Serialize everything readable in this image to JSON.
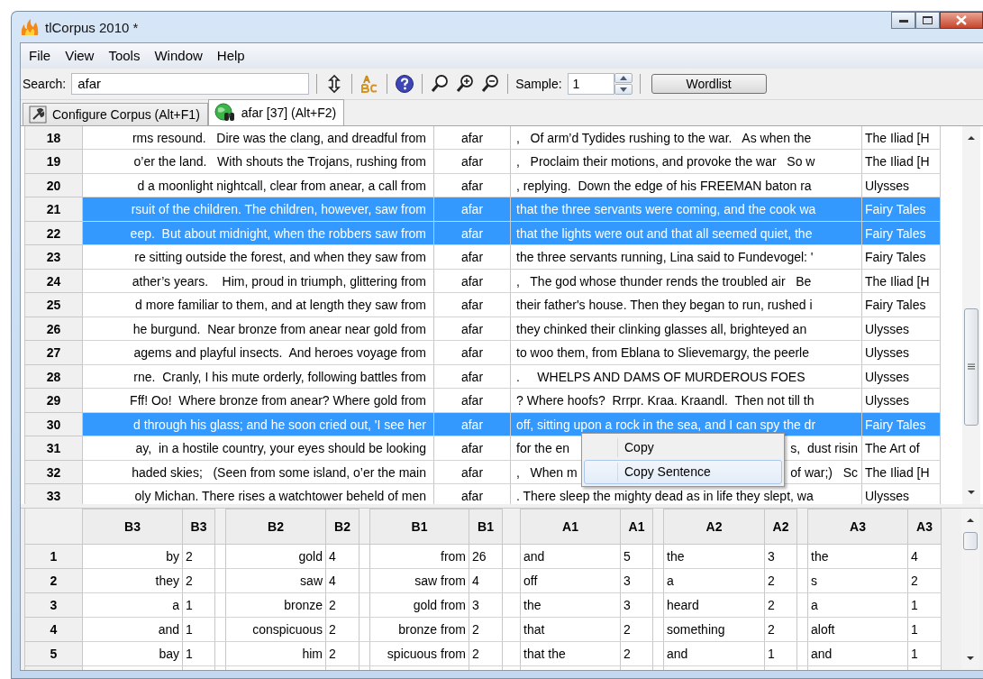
{
  "window": {
    "title": "tlCorpus 2010 *"
  },
  "menu": [
    "File",
    "View",
    "Tools",
    "Window",
    "Help"
  ],
  "toolbar": {
    "search_label": "Search:",
    "search_value": "afar",
    "sample_label": "Sample:",
    "sample_value": "1",
    "wordlist_button": "Wordlist"
  },
  "tabs": [
    {
      "label": "Configure Corpus (Alt+F1)",
      "selected": false,
      "kind": "config"
    },
    {
      "label": "afar [37] (Alt+F2)",
      "selected": true,
      "kind": "results"
    }
  ],
  "concordance": {
    "rows": [
      {
        "n": "18",
        "left": "rms resound.   Dire was the clang, and dreadful from",
        "key": "afar",
        "right": ",   Of arm’d Tydides rushing to the war.   As when the",
        "source": "The Iliad [H",
        "selected": false
      },
      {
        "n": "19",
        "left": " o’er the land.   With shouts the Trojans, rushing from",
        "key": "afar",
        "right": ",   Proclaim their motions, and provoke the war   So w",
        "source": "The Iliad [H",
        "selected": false
      },
      {
        "n": "20",
        "left": "d a moonlight nightcall, clear from anear, a call from",
        "key": "afar",
        "right": ", replying.  Down the edge of his FREEMAN baton ra",
        "source": "Ulysses",
        "selected": false
      },
      {
        "n": "21",
        "left": "rsuit of the children. The children, however, saw from",
        "key": "afar",
        "right": "that the three servants were coming, and the cook wa",
        "source": "Fairy Tales",
        "selected": true
      },
      {
        "n": "22",
        "left": "eep.  But about midnight, when the robbers saw from",
        "key": "afar",
        "right": "that the lights were out and that all seemed quiet, the",
        "source": "Fairy Tales",
        "selected": true
      },
      {
        "n": "23",
        "left": "re sitting outside the forest, and when they saw from",
        "key": "afar",
        "right": "the three servants running, Lina said to Fundevogel: '",
        "source": "Fairy Tales",
        "selected": false
      },
      {
        "n": "24",
        "left": "ather’s years.    Him, proud in triumph, glittering from",
        "key": "afar",
        "right": ",   The god whose thunder rends the troubled air   Be",
        "source": "The Iliad [H",
        "selected": false
      },
      {
        "n": "25",
        "left": "d more familiar to them, and at length they saw from",
        "key": "afar",
        "right": "their father's house. Then they began to run, rushed i",
        "source": "Fairy Tales",
        "selected": false
      },
      {
        "n": "26",
        "left": "he burgund.  Near bronze from anear near gold from",
        "key": "afar",
        "right": "they chinked their clinking glasses all, brighteyed an",
        "source": "Ulysses",
        "selected": false
      },
      {
        "n": "27",
        "left": "agems and playful insects.  And heroes voyage from",
        "key": "afar",
        "right": "to woo them, from Eblana to Slievemargy, the peerle",
        "source": "Ulysses",
        "selected": false
      },
      {
        "n": "28",
        "left": "rne.  Cranly, I his mute orderly, following battles from",
        "key": "afar",
        "right": ".     WHELPS AND DAMS OF MURDEROUS FOES",
        "source": "Ulysses",
        "selected": false
      },
      {
        "n": "29",
        "left": "Fff! Oo!  Where bronze from anear? Where gold from",
        "key": "afar",
        "right": "? Where hoofs?  Rrrpr. Kraa. Kraandl.  Then not till th",
        "source": "Ulysses",
        "selected": false
      },
      {
        "n": "30",
        "left": "d through his glass; and he soon cried out, 'I see her",
        "key": "afar",
        "right": "off, sitting upon a rock in the sea, and I can spy the dr",
        "source": "Fairy Tales",
        "selected": true
      },
      {
        "n": "31",
        "left": "ay,  in a hostile country, your eyes should be looking",
        "key": "afar",
        "right": "for the en",
        "right_tail": "s,  dust risin",
        "source": "The Art of",
        "selected": false
      },
      {
        "n": "32",
        "left": "haded skies;   (Seen from some island, o’er the main",
        "key": "afar",
        "right": ",   When m",
        "right_tail": "of war;)   Sc",
        "source": "The Iliad [H",
        "selected": false
      },
      {
        "n": "33",
        "left": "oly Michan. There rises a watchtower beheld of men",
        "key": "afar",
        "right": ". There sleep the mighty dead as in life they slept, wa",
        "source": "Ulysses",
        "selected": false
      }
    ]
  },
  "context_menu": [
    {
      "label": "Copy",
      "selected": false
    },
    {
      "label": "Copy Sentence",
      "selected": true
    }
  ],
  "collocates": {
    "row_numbers": [
      "1",
      "2",
      "3",
      "4",
      "5"
    ],
    "groups": [
      {
        "header": "B3",
        "count_header": "B3",
        "kind": "before",
        "rows": [
          [
            "by",
            "2"
          ],
          [
            "they",
            "2"
          ],
          [
            "a",
            "1"
          ],
          [
            "and",
            "1"
          ],
          [
            "bay",
            "1"
          ]
        ]
      },
      {
        "header": "B2",
        "count_header": "B2",
        "kind": "before",
        "rows": [
          [
            "gold",
            "4"
          ],
          [
            "saw",
            "4"
          ],
          [
            "bronze",
            "2"
          ],
          [
            "conspicuous",
            "2"
          ],
          [
            "him",
            "2"
          ]
        ]
      },
      {
        "header": "B1",
        "count_header": "B1",
        "kind": "before",
        "rows": [
          [
            "from",
            "26"
          ],
          [
            "saw from",
            "4"
          ],
          [
            "gold from",
            "3"
          ],
          [
            "bronze from",
            "2"
          ],
          [
            "spicuous from",
            "2"
          ]
        ]
      },
      {
        "header": "A1",
        "count_header": "A1",
        "kind": "after",
        "rows": [
          [
            "and",
            "5"
          ],
          [
            "off",
            "3"
          ],
          [
            "the",
            "3"
          ],
          [
            "that",
            "2"
          ],
          [
            "that the",
            "2"
          ]
        ]
      },
      {
        "header": "A2",
        "count_header": "A2",
        "kind": "after",
        "rows": [
          [
            "the",
            "3"
          ],
          [
            "a",
            "2"
          ],
          [
            "heard",
            "2"
          ],
          [
            "something",
            "2"
          ],
          [
            "and",
            "1"
          ]
        ]
      },
      {
        "header": "A3",
        "count_header": "A3",
        "kind": "after",
        "rows": [
          [
            "the",
            "4"
          ],
          [
            "s",
            "2"
          ],
          [
            "a",
            "1"
          ],
          [
            "aloft",
            "1"
          ],
          [
            "and",
            "1"
          ]
        ]
      }
    ]
  }
}
